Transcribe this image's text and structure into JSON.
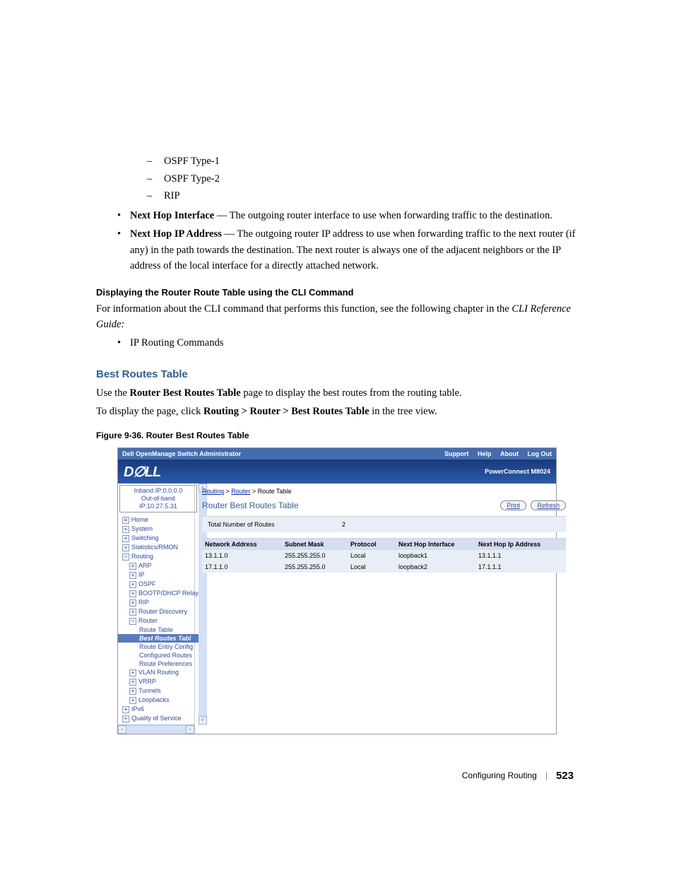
{
  "protocols": {
    "a": "OSPF Type-1",
    "b": "OSPF Type-2",
    "c": "RIP"
  },
  "bullets": {
    "nhi": {
      "label": "Next Hop Interface",
      "text": " — The outgoing router interface to use when forwarding traffic to the destination."
    },
    "nhip": {
      "label": "Next Hop IP Address",
      "text": " — The outgoing router IP address to use when forwarding traffic to the next router (if any) in the path towards the destination. The next router is always one of the adjacent neighbors or the IP address of the local interface for a directly attached network."
    }
  },
  "cli_h": "Displaying the Router Route Table using the CLI Command",
  "cli_p1": "For information about the CLI command that performs this function, see the following chapter in the ",
  "cli_ref": "CLI Reference Guide:",
  "cli_item": "IP Routing Commands",
  "sect_h": "Best Routes Table",
  "sect_p1a": "Use the ",
  "sect_p1b": "Router Best Routes Table",
  "sect_p1c": " page to display the best routes from the routing table.",
  "sect_p2a": "To display the page, click ",
  "sect_p2b": "Routing > Router > Best Routes Table",
  "sect_p2c": " in the tree view.",
  "fig_cap": "Figure 9-36.    Router Best Routes Table",
  "shot": {
    "app_title": "Dell OpenManage Switch Administrator",
    "links": {
      "support": "Support",
      "help": "Help",
      "about": "About",
      "logout": "Log Out"
    },
    "logo": "D∅LL",
    "model": "PowerConnect M8024",
    "ip1": "Inband IP:0.0.0.0",
    "ip2": "Out-of-band IP:10.27.5.31",
    "tree": {
      "home": "Home",
      "system": "System",
      "switching": "Switching",
      "stats": "Statistics/RMON",
      "routing": "Routing",
      "arp": "ARP",
      "ip": "IP",
      "ospf": "OSPF",
      "bootp": "BOOTP/DHCP Relay",
      "rip": "RIP",
      "rd": "Router Discovery",
      "router": "Router",
      "rtbl": "Route Table",
      "best": "Best Routes Tabl",
      "rec": "Route Entry Config",
      "cr": "Configured Routes",
      "rp": "Route Preferences",
      "vlan": "VLAN Routing",
      "vrrp": "VRRP",
      "tun": "Tunnels",
      "loop": "Loopbacks",
      "ipv6": "IPv6",
      "qos": "Quality of Service"
    },
    "crumb": {
      "a": "Routing",
      "b": "Router",
      "c": "Route Table",
      "sep": " > "
    },
    "panel_title": "Router Best Routes Table",
    "btn_print": "Print",
    "btn_refresh": "Refresh",
    "total_lbl": "Total Number of Routes",
    "total_val": "2",
    "hd": {
      "na": "Network Address",
      "sm": "Subnet Mask",
      "pr": "Protocol",
      "nh": "Next Hop Interface",
      "ip": "Next Hop Ip Address"
    },
    "rows": [
      {
        "na": "13.1.1.0",
        "sm": "255.255.255.0",
        "pr": "Local",
        "nh": "loopback1",
        "ip": "13.1.1.1"
      },
      {
        "na": "17.1.1.0",
        "sm": "255.255.255.0",
        "pr": "Local",
        "nh": "loopback2",
        "ip": "17.1.1.1"
      }
    ]
  },
  "footer": {
    "section": "Configuring Routing",
    "page": "523"
  }
}
